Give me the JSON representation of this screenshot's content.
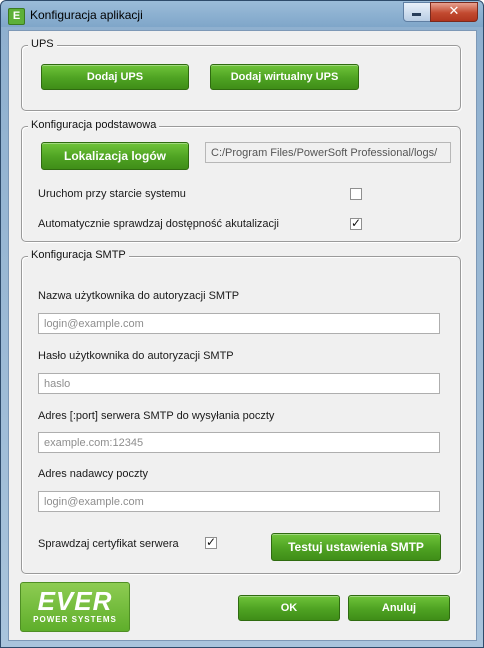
{
  "window": {
    "title": "Konfiguracja aplikacji",
    "icon_letter": "E",
    "close_glyph": "✕"
  },
  "ups": {
    "legend": "UPS",
    "add_ups_label": "Dodaj UPS",
    "add_virtual_ups_label": "Dodaj wirtualny UPS"
  },
  "basic": {
    "legend": "Konfiguracja podstawowa",
    "log_location_label": "Lokalizacja logów",
    "log_path": "C:/Program Files/PowerSoft Professional/logs/",
    "autostart_label": "Uruchom przy starcie systemu",
    "autostart_checked": false,
    "auto_update_label": "Automatycznie sprawdzaj dostępność akutalizacji",
    "auto_update_checked": true
  },
  "smtp": {
    "legend": "Konfiguracja SMTP",
    "username_label": "Nazwa użytkownika do autoryzacji SMTP",
    "username_placeholder": "login@example.com",
    "password_label": "Hasło użytkownika do autoryzacji SMTP",
    "password_placeholder": "haslo",
    "server_label": "Adres [:port] serwera SMTP do wysyłania poczty",
    "server_placeholder": "example.com:12345",
    "sender_label": "Adres nadawcy poczty",
    "sender_placeholder": "login@example.com",
    "verify_cert_label": "Sprawdzaj certyfikat serwera",
    "verify_cert_checked": true,
    "test_button_label": "Testuj ustawienia SMTP"
  },
  "footer": {
    "logo_text": "EVER",
    "logo_subtext": "POWER SYSTEMS",
    "ok_label": "OK",
    "cancel_label": "Anuluj"
  },
  "colors": {
    "button_green": "#4ea222",
    "title_bar": "#9bbcd9",
    "close_red": "#c24a30"
  },
  "icons": {
    "app": "ever-app-icon",
    "minimize": "minimize-icon",
    "close": "close-icon",
    "check": "checkmark-icon"
  }
}
